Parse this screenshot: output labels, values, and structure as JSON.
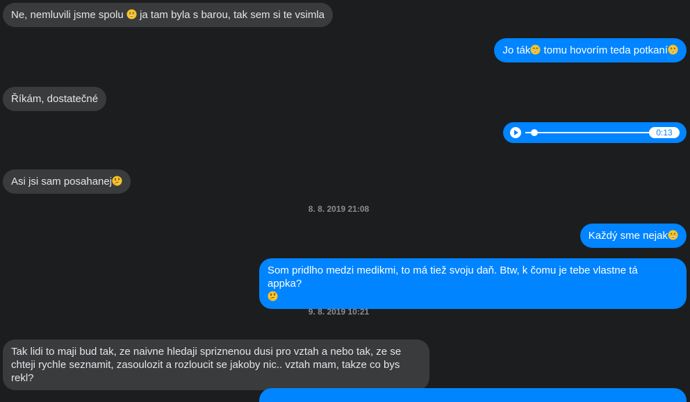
{
  "messages": [
    {
      "id": "m1",
      "dir": "in",
      "parts": [
        "Ne, nemluvili jsme spolu ",
        "grin",
        " ja tam byla s barou, tak sem si te vsimla"
      ]
    },
    {
      "id": "m2",
      "dir": "out",
      "parts": [
        "Jo ták",
        "sweat-smile",
        " tomu hovorím teda potkaní",
        "grin"
      ]
    },
    {
      "id": "m3",
      "dir": "in",
      "parts": [
        "Říkám, dostatečné"
      ]
    },
    {
      "id": "m4",
      "dir": "out",
      "type": "audio",
      "duration": "0:13"
    },
    {
      "id": "m5",
      "dir": "in",
      "parts": [
        "Asi jsi sam posahanej",
        "thinking"
      ]
    },
    {
      "id": "m6",
      "dir": "out",
      "parts": [
        "Každý sme nejak",
        "grin"
      ]
    },
    {
      "id": "m7",
      "dir": "out",
      "parts": [
        "Som pridlho medzi medikmi, to má tiež svoju daň. Btw, k čomu je tebe vlastne tá appka?",
        "thinking"
      ]
    },
    {
      "id": "m8",
      "dir": "in",
      "parts": [
        "Tak lidi to maji bud tak, ze naivne hledaji spriznenou dusi pro vztah a nebo tak, ze se chteji rychle seznamit,  zasoulozit a rozloucit se jakoby nic.. vztah mam, takze co bys rekl?"
      ]
    }
  ],
  "timestamps": {
    "t1": "8. 8. 2019 21:08",
    "t2": "9. 8. 2019 10:21"
  },
  "audio": {
    "duration": "0:13",
    "play_icon": "play-icon"
  },
  "colors": {
    "background": "#1c1d1f",
    "incoming": "#3a3b3c",
    "outgoing": "#0084ff",
    "timestamp": "#8a8d91"
  }
}
